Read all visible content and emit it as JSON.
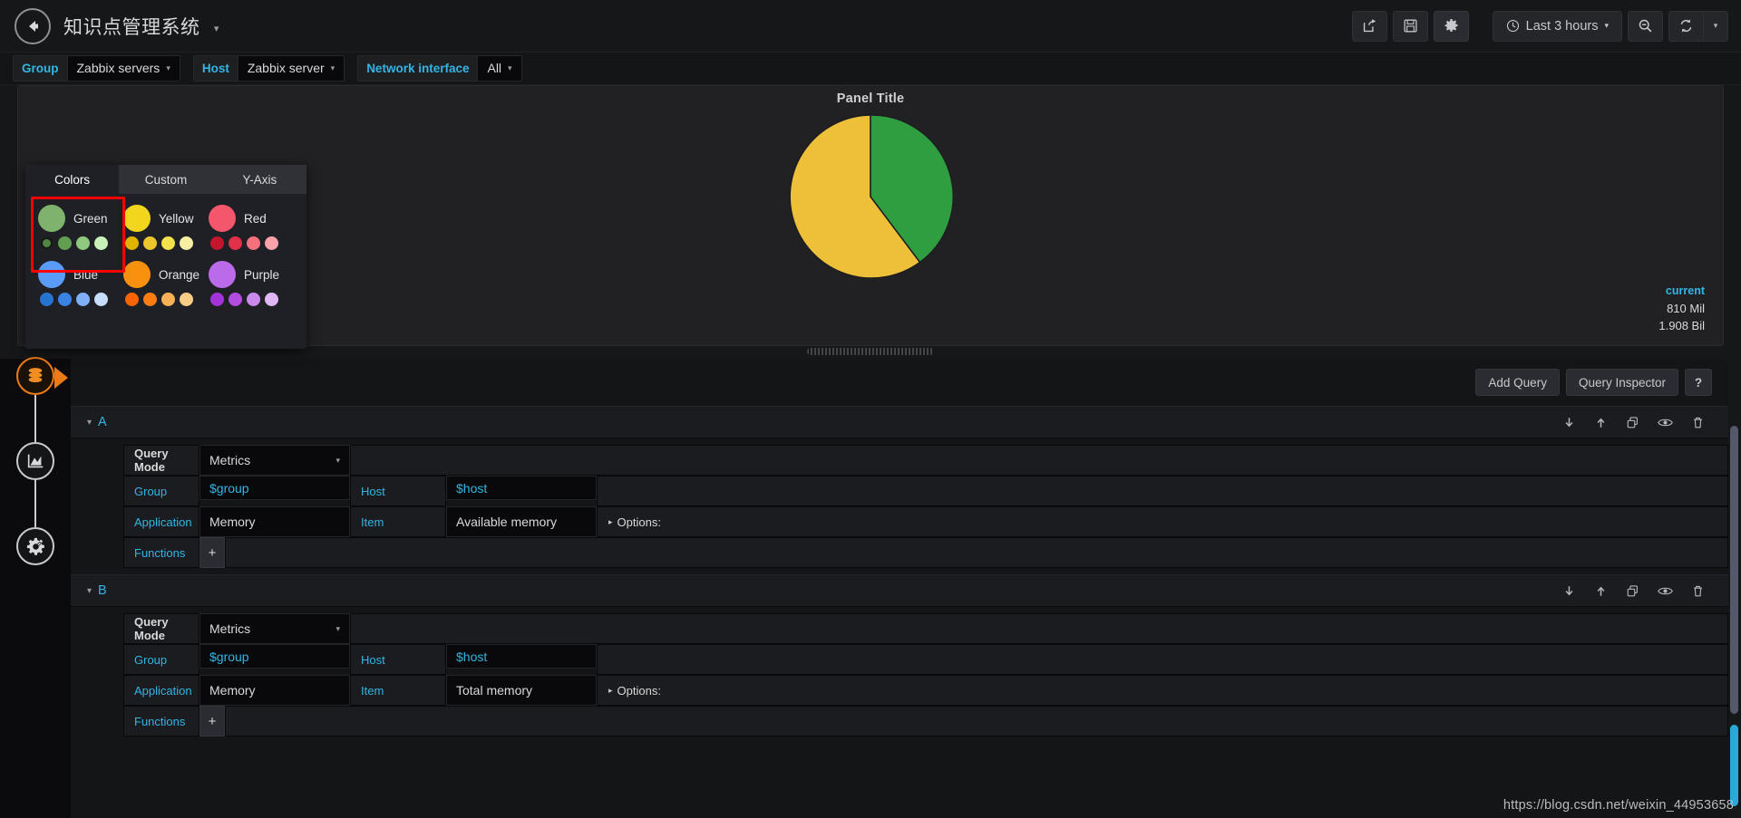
{
  "navbar": {
    "back_icon": "arrow-left-circle-icon",
    "title": "知识点管理系统",
    "title_caret": "▾",
    "buttons": [
      {
        "name": "share-dashboard-button",
        "icon": "share-icon"
      },
      {
        "name": "save-dashboard-button",
        "icon": "save-floppy-icon"
      },
      {
        "name": "dashboard-settings-button",
        "icon": "gear-icon"
      }
    ],
    "time_picker": {
      "label": "Last 3 hours",
      "icon": "clock-icon",
      "caret": "▾"
    },
    "zoom_out": {
      "name": "zoom-out-button",
      "icon": "magnifier-minus-icon"
    },
    "refresh": {
      "name": "refresh-button",
      "icon": "refresh-icon"
    },
    "refresh_interval": {
      "name": "refresh-interval-dropdown",
      "caret": "▾"
    }
  },
  "submenu": {
    "variables": [
      {
        "label": "Group",
        "value": "Zabbix servers",
        "caret": "▾"
      },
      {
        "label": "Host",
        "value": "Zabbix server",
        "caret": "▾"
      },
      {
        "label": "Network interface",
        "value": "All",
        "caret": "▾"
      }
    ]
  },
  "panel": {
    "title": "Panel Title",
    "legend": {
      "header": "current",
      "values": [
        "810 Mil",
        "1.908 Bil"
      ]
    }
  },
  "chart_data": {
    "type": "pie",
    "title": "Panel Title",
    "labels": [
      "Available memory",
      "Total memory"
    ],
    "values": [
      810,
      1908
    ],
    "display_values": [
      "810 Mil",
      "1.908 Bil"
    ],
    "colors": [
      "#2f9e41",
      "#eec03a"
    ],
    "legend_position": "right",
    "legend_header": "current",
    "start_angle": 0,
    "grid": false
  },
  "colorpicker": {
    "tabs": [
      {
        "label": "Colors",
        "active": true
      },
      {
        "label": "Custom",
        "active": false
      },
      {
        "label": "Y-Axis",
        "active": false
      }
    ],
    "highlighted_swatch": "Green",
    "swatches": [
      {
        "name": "Green",
        "main": "#7eb26d",
        "shades": [
          "#508642",
          "#629e51",
          "#8fc97f",
          "#c8f0b8"
        ],
        "selected_index": 0
      },
      {
        "name": "Yellow",
        "main": "#f2d51d",
        "shades": [
          "#e0b400",
          "#eac72b",
          "#f3e24c",
          "#f7f0a3"
        ],
        "selected_index": -1
      },
      {
        "name": "Red",
        "main": "#f4576b",
        "shades": [
          "#c3152b",
          "#e0304a",
          "#f4707f",
          "#f9a2ab"
        ],
        "selected_index": -1
      },
      {
        "name": "Blue",
        "main": "#5a9bf8",
        "shades": [
          "#2574cd",
          "#3a82e3",
          "#7fb0f7",
          "#c6ddfb"
        ],
        "selected_index": -1
      },
      {
        "name": "Orange",
        "main": "#f9900e",
        "shades": [
          "#fa6400",
          "#fb7c10",
          "#f7b055",
          "#f9cc86"
        ],
        "selected_index": -1
      },
      {
        "name": "Purple",
        "main": "#bb6bea",
        "shades": [
          "#a233d8",
          "#b34ce0",
          "#cb8aeb",
          "#e0b6f3"
        ],
        "selected_index": -1
      }
    ]
  },
  "edit_sidebar": {
    "items": [
      {
        "name": "datasource-tab",
        "icon": "database-icon",
        "active": true
      },
      {
        "name": "visualization-tab",
        "icon": "graph-area-icon",
        "active": false
      },
      {
        "name": "general-settings-tab",
        "icon": "gear-wrench-icon",
        "active": false
      }
    ]
  },
  "query_toolbar": {
    "add_query": "Add Query",
    "query_inspector": "Query Inspector",
    "help": "?"
  },
  "queries": [
    {
      "letter": "A",
      "caret": "▾",
      "actions": [
        {
          "name": "move-query-down-icon",
          "glyph": "down-arrow-icon"
        },
        {
          "name": "move-query-up-icon",
          "glyph": "up-arrow-icon"
        },
        {
          "name": "duplicate-query-icon",
          "glyph": "copy-icon"
        },
        {
          "name": "toggle-query-visibility-icon",
          "glyph": "eye-icon"
        },
        {
          "name": "remove-query-icon",
          "glyph": "trash-icon"
        }
      ],
      "rows": {
        "query_mode_label": "Query Mode",
        "query_mode_value": "Metrics",
        "group_label": "Group",
        "group_value": "$group",
        "host_label": "Host",
        "host_value": "$host",
        "application_label": "Application",
        "application_value": "Memory",
        "item_label": "Item",
        "item_value": "Available memory",
        "options_label": "Options:",
        "functions_label": "Functions",
        "functions_add": "+"
      }
    },
    {
      "letter": "B",
      "caret": "▾",
      "actions": [
        {
          "name": "move-query-down-icon",
          "glyph": "down-arrow-icon"
        },
        {
          "name": "move-query-up-icon",
          "glyph": "up-arrow-icon"
        },
        {
          "name": "duplicate-query-icon",
          "glyph": "copy-icon"
        },
        {
          "name": "toggle-query-visibility-icon",
          "glyph": "eye-icon"
        },
        {
          "name": "remove-query-icon",
          "glyph": "trash-icon"
        }
      ],
      "rows": {
        "query_mode_label": "Query Mode",
        "query_mode_value": "Metrics",
        "group_label": "Group",
        "group_value": "$group",
        "host_label": "Host",
        "host_value": "$host",
        "application_label": "Application",
        "application_value": "Memory",
        "item_label": "Item",
        "item_value": "Total memory",
        "options_label": "Options:",
        "functions_label": "Functions",
        "functions_add": "+"
      }
    }
  ],
  "watermark": "https://blog.csdn.net/weixin_44953658",
  "theme": {
    "bg": "#161719",
    "panel_bg": "#212124",
    "accent_blue": "#33b5e5",
    "accent_orange": "#eb7b18",
    "highlight_red": "#ff0000"
  }
}
